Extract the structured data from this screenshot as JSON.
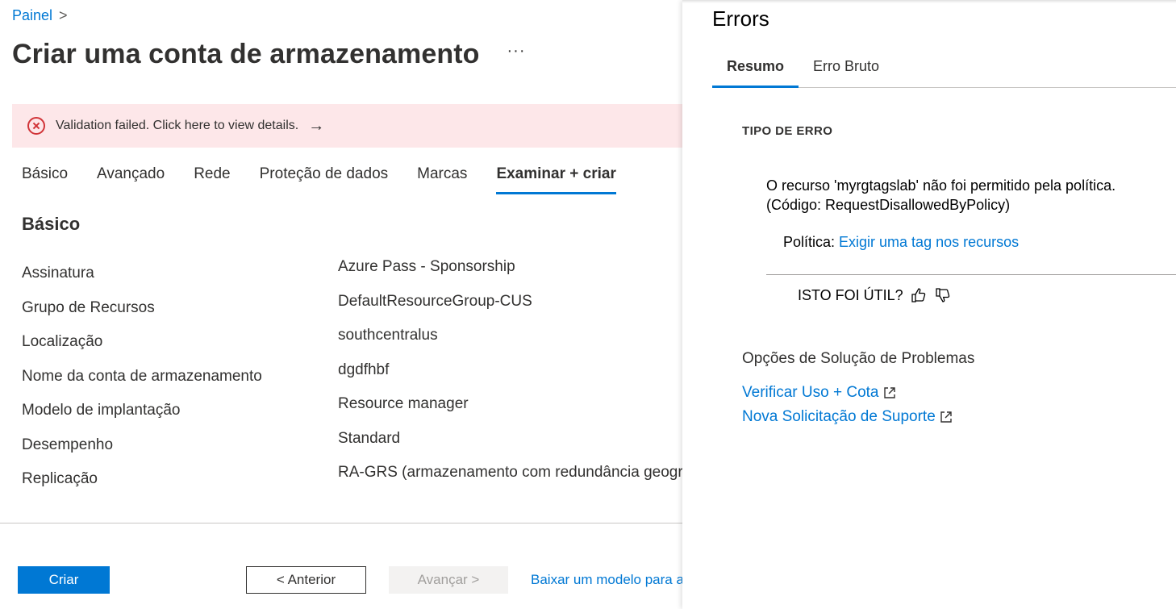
{
  "breadcrumb": {
    "item": "Painel",
    "separator": ">"
  },
  "header": {
    "title": "Criar uma conta de armazenamento",
    "more": "···"
  },
  "alert": {
    "text": "Validation failed. Click here to view details.",
    "arrow": "→",
    "icon": "error-circle-icon",
    "color": "#d13438"
  },
  "tabs": [
    {
      "label": "Básico"
    },
    {
      "label": "Avançado"
    },
    {
      "label": "Rede"
    },
    {
      "label": "Proteção de dados"
    },
    {
      "label": "Marcas"
    },
    {
      "label": "Examinar + criar",
      "active": true
    }
  ],
  "section": {
    "title": "Básico"
  },
  "fields": [
    {
      "label": "Assinatura",
      "value": "Azure Pass - Sponsorship"
    },
    {
      "label": "Grupo de Recursos",
      "value": "DefaultResourceGroup-CUS"
    },
    {
      "label": "Localização",
      "value": "southcentralus"
    },
    {
      "label": "Nome da conta de armazenamento",
      "value": "dgdfhbf"
    },
    {
      "label": "Modelo de implantação",
      "value": "Resource manager"
    },
    {
      "label": "Desempenho",
      "value": "Standard"
    },
    {
      "label": "Replicação",
      "value": "RA-GRS (armazenamento com redundância geográfica com acesso de leitura)"
    }
  ],
  "footer": {
    "create": "Criar",
    "previous": "< Anterior",
    "next": "Avançar >",
    "download": "Baixar um modelo para automação"
  },
  "errors_panel": {
    "title": "Errors",
    "tabs": [
      {
        "label": "Resumo",
        "active": true
      },
      {
        "label": "Erro Bruto"
      }
    ],
    "type_heading": "TIPO DE ERRO",
    "message_line1": "O recurso 'myrgtagslab' não foi permitido pela política.",
    "message_line2": "(Código: RequestDisallowedByPolicy)",
    "policy_label": "Política: ",
    "policy_link": "Exigir uma tag nos recursos",
    "helpful": "ISTO FOI ÚTIL?",
    "troubleshoot_heading": "Opções de Solução de Problemas",
    "links": [
      "Verificar Uso + Cota",
      "Nova Solicitação de Suporte"
    ]
  },
  "colors": {
    "accent": "#0078d4",
    "error": "#d13438",
    "alert_bg": "#fde7e9"
  }
}
